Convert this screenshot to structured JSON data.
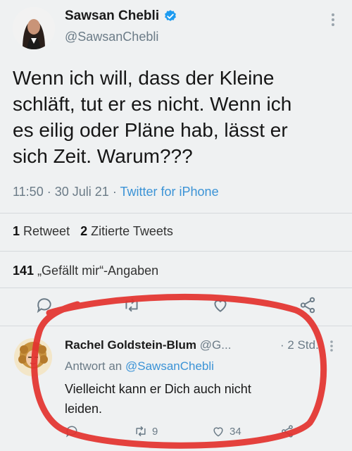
{
  "tweet": {
    "author_name": "Sawsan Chebli",
    "handle": "@SawsanChebli",
    "lines": [
      "Wenn ich will, dass der Kleine",
      "schläft, tut er es nicht. Wenn ich",
      "es eilig oder Pläne hab, lässt er",
      "sich Zeit. Warum???"
    ],
    "time": "11:50",
    "date": "30 Juli 21",
    "source": "Twitter for iPhone",
    "separator": "·"
  },
  "stats": {
    "retweets_count": "1",
    "retweets_label": "Retweet",
    "quotes_count": "2",
    "quotes_label": "Zitierte Tweets",
    "likes_count": "141",
    "likes_label": "„Gefällt mir“-Angaben"
  },
  "reply": {
    "author_name": "Rachel Goldstein-Blum",
    "handle": "@G...",
    "time": "· 2 Std.",
    "reply_to_label": "Antwort an",
    "reply_to_handle": "@SawsanChebli",
    "lines": [
      "Vielleicht kann er Dich auch nicht",
      "leiden."
    ],
    "retweet_count": "9",
    "like_count": "34"
  },
  "colors": {
    "background": "#eff1f2",
    "link": "#3b93d6",
    "secondary_text": "#6b7b87",
    "verified_badge": "#1d9bf0",
    "annotation_circle": "#e3322e"
  },
  "icons": [
    "more-icon",
    "verified-badge-icon",
    "reply-icon",
    "retweet-icon",
    "like-icon",
    "share-icon"
  ]
}
